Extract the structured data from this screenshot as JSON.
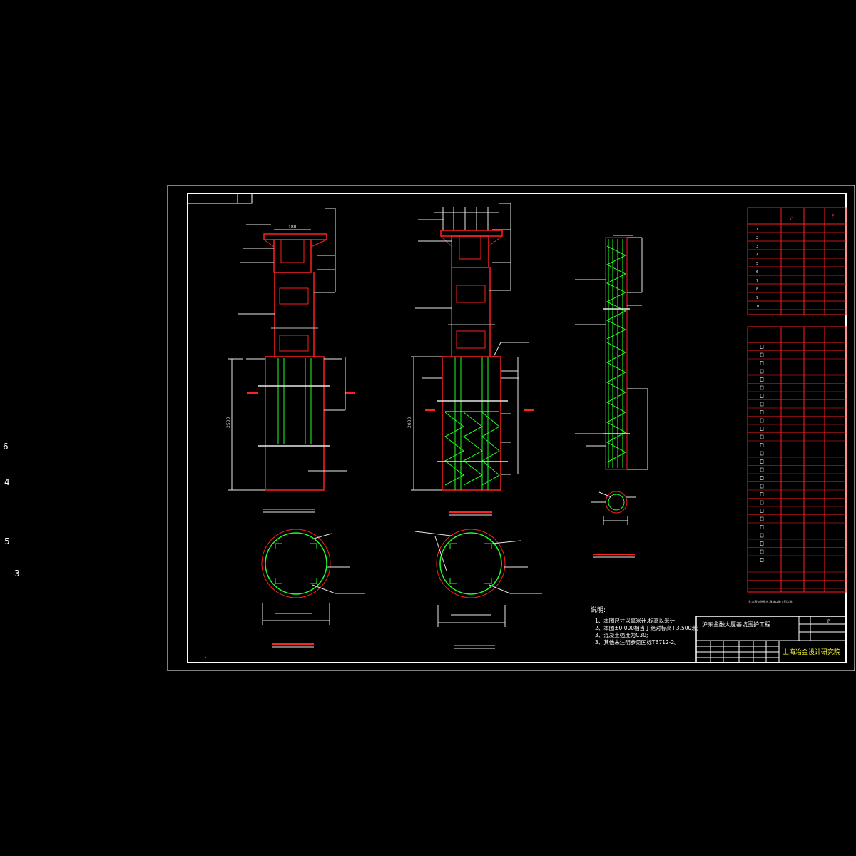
{
  "left_marks": [
    "6",
    "4",
    "5",
    "3"
  ],
  "notes": {
    "heading": "说明:",
    "items": [
      "1、本图尺寸以毫米计,标高以米计;",
      "2、本图±0.000相当于绝对标高+3.500米;",
      "3、混凝土强度为C30;",
      "3、其他未注明参见国标TB712-2。"
    ]
  },
  "title_block": {
    "project": "沪东金融大厦基坑围护工程",
    "institute": "上海冶金设计研究院",
    "sheet": "P"
  },
  "dims": {
    "top_width": "180",
    "left_height": "2500",
    "mid_height": "2000"
  },
  "table_top": {
    "header": [
      "",
      "C",
      "F"
    ],
    "row_marks": [
      "1",
      "2",
      "3",
      "4",
      "5",
      "6",
      "7",
      "8",
      "9",
      "10"
    ]
  },
  "table_bottom": {
    "footnote": "注:本表仅供参考,具体以施工图为准。"
  },
  "colors": {
    "background": "#000000",
    "frame": "#ffffff",
    "concrete": "#ff2020",
    "rebar": "#20ff20",
    "dimension": "#e8e8e8",
    "institute_text": "#ffff40"
  }
}
